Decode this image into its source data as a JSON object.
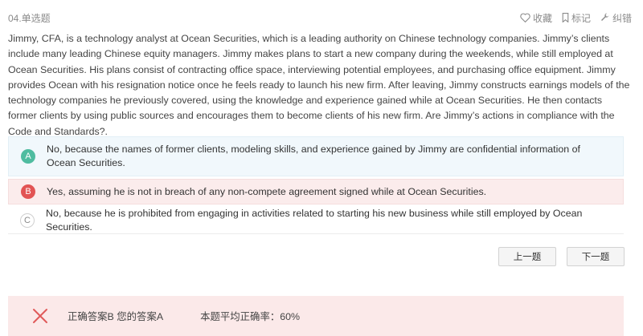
{
  "header": {
    "question_label": "04.单选题",
    "favorite_label": "收藏",
    "mark_label": "标记",
    "report_label": "纠错"
  },
  "question": {
    "text": "Jimmy, CFA, is a technology analyst at Ocean Securities, which is a leading authority on Chinese technology companies. Jimmy’s clients include many leading Chinese equity managers. Jimmy makes plans to start a new company during the weekends, while still employed at Ocean Securities. His plans consist of contracting office space, interviewing potential employees, and purchasing office equipment. Jimmy provides Ocean with his resignation notice once he feels ready to launch his new firm. After leaving, Jimmy constructs earnings models of the technology companies he previously covered, using the knowledge and experience gained while at Ocean Securities. He then contacts former clients by using public sources and encourages them to become clients of his new firm. Are Jimmy’s actions in compliance with the Code and Standards?."
  },
  "options": [
    {
      "letter": "A",
      "text": "No, because the names of former clients, modeling skills, and experience gained by Jimmy are confidential information of Ocean Securities.",
      "state": "selected"
    },
    {
      "letter": "B",
      "text": "Yes, assuming he is not in breach of any non-compete agreement signed while at Ocean Securities.",
      "state": "correct"
    },
    {
      "letter": "C",
      "text": "No, because he is prohibited from engaging in activities related to starting his new business while still employed by Ocean Securities.",
      "state": "none"
    }
  ],
  "nav": {
    "prev_label": "上一题",
    "next_label": "下一题"
  },
  "result": {
    "answer_text": "正确答案B 您的答案A",
    "rate_text": "本题平均正确率：60%"
  },
  "colors": {
    "selected_badge": "#4fbca0",
    "correct_badge": "#e25454",
    "result_bg": "#fbe9e9",
    "x_mark": "#e05a5a"
  }
}
